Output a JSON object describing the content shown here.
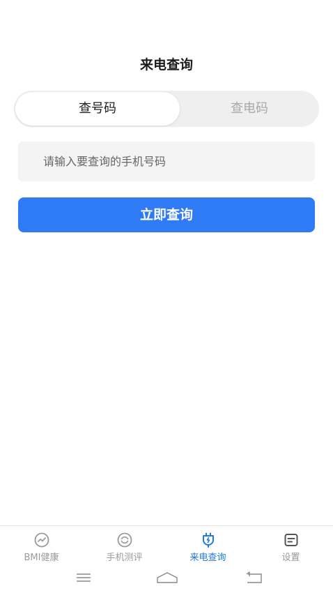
{
  "header": {
    "title": "来电查询"
  },
  "segment": {
    "tabs": [
      {
        "label": "查号码",
        "active": true
      },
      {
        "label": "查电码",
        "active": false
      }
    ]
  },
  "search": {
    "placeholder": "请输入要查询的手机号码",
    "value": ""
  },
  "actions": {
    "query_label": "立即查询"
  },
  "colors": {
    "accent": "#2f7bf6",
    "tab_active": "#1f7ad8",
    "tab_inactive": "#9a9a9a"
  },
  "tabbar": {
    "items": [
      {
        "label": "BMI健康",
        "icon": "trend-circle-icon",
        "active": false
      },
      {
        "label": "手机测评",
        "icon": "gauge-circle-icon",
        "active": false
      },
      {
        "label": "来电查询",
        "icon": "charger-plug-icon",
        "active": true
      },
      {
        "label": "设置",
        "icon": "settings-card-icon",
        "active": false
      }
    ]
  },
  "system_nav": {
    "buttons": [
      "menu-icon",
      "home-icon",
      "back-icon"
    ]
  }
}
